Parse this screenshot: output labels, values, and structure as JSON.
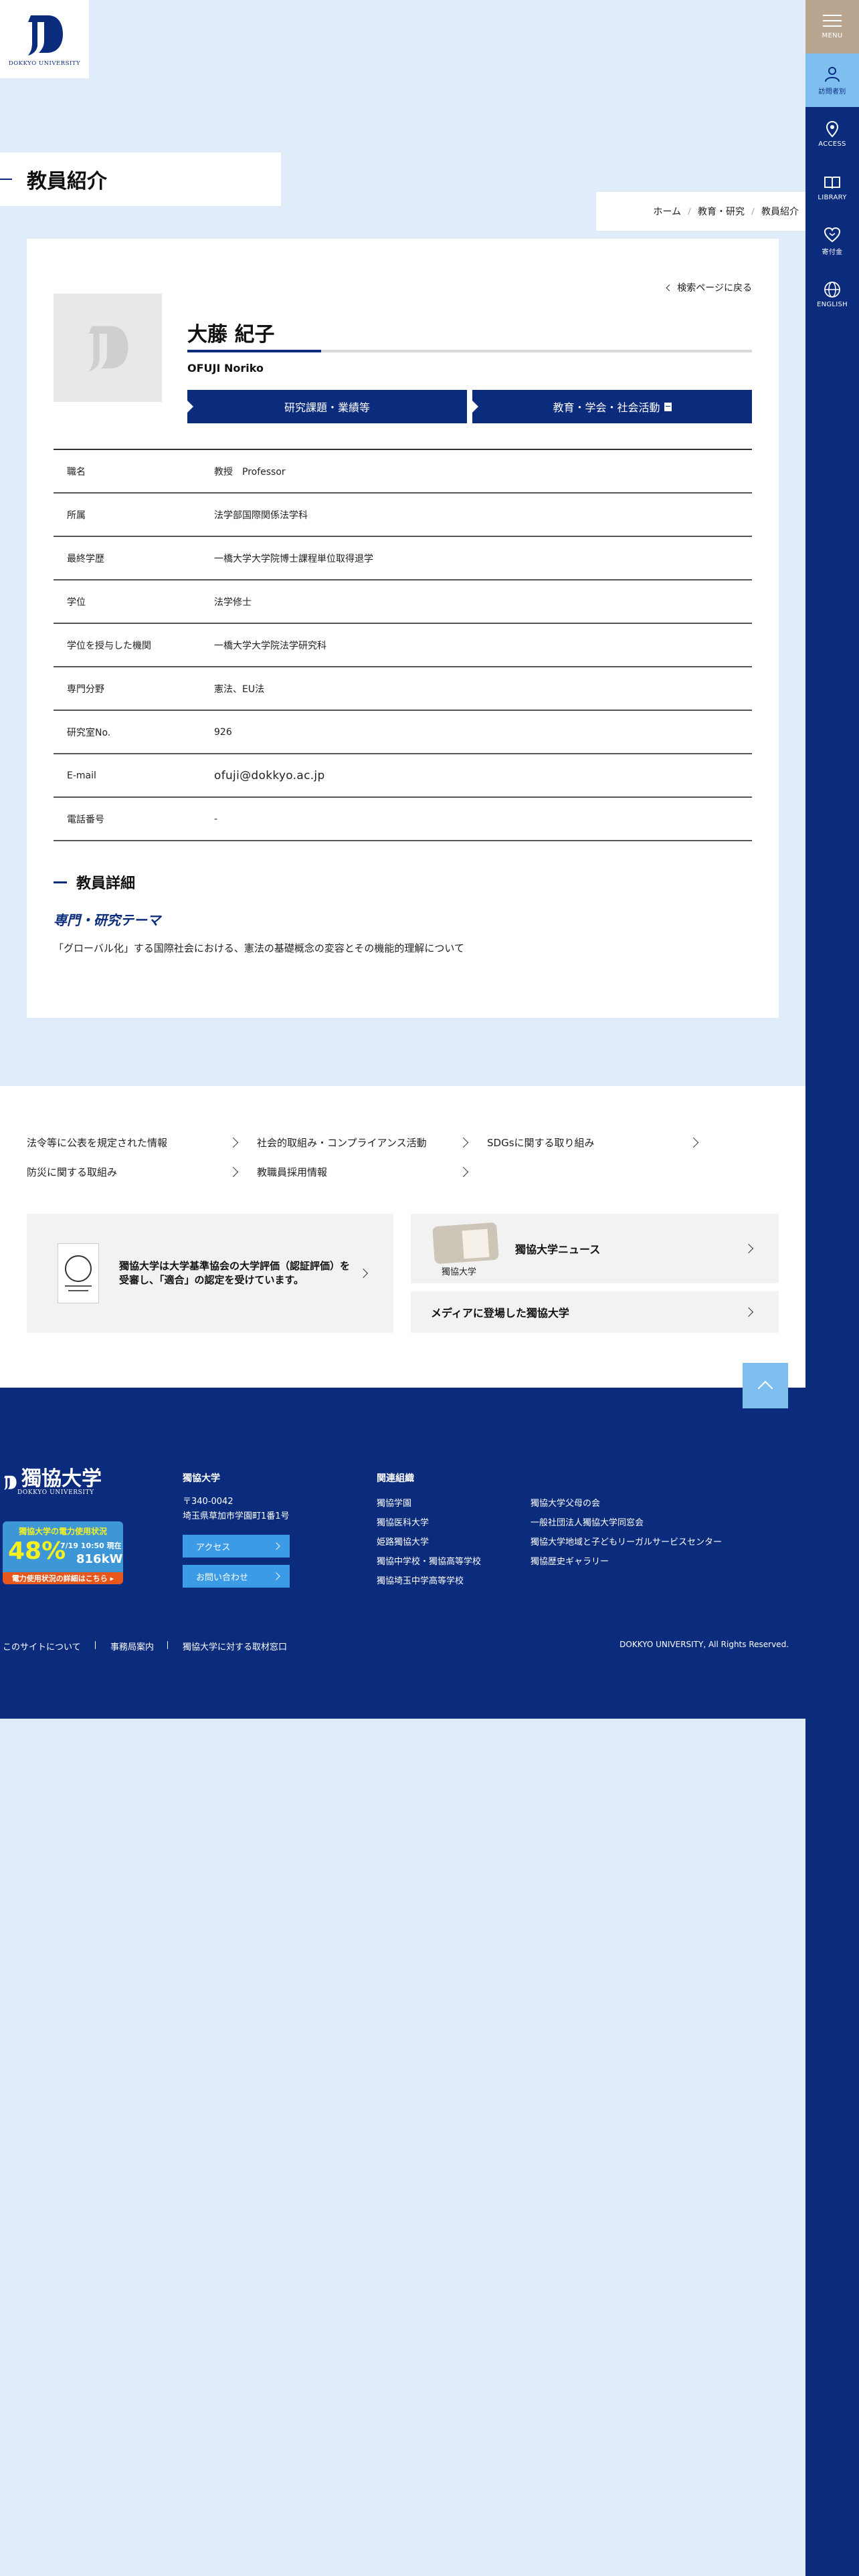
{
  "logo": {
    "text": "DOKKYO UNIVERSITY"
  },
  "rail": {
    "menu": "MENU",
    "visitor": "訪問者別",
    "access": "ACCESS",
    "library": "LIBRARY",
    "donation": "寄付金",
    "english": "ENGLISH"
  },
  "page": {
    "title": "教員紹介",
    "breadcrumb": [
      "ホーム",
      "教育・研究",
      "教員紹介"
    ]
  },
  "profile": {
    "back_label": "検索ページに戻る",
    "name": "大藤 紀子",
    "name_roman": "OFUJI Noriko",
    "tab_research": "研究課題・業績等",
    "tab_education": "教育・学会・社会活動",
    "rows": [
      {
        "key": "職名",
        "value": "教授　Professor"
      },
      {
        "key": "所属",
        "value": "法学部国際関係法学科"
      },
      {
        "key": "最終学歴",
        "value": "一橋大学大学院博士課程単位取得退学"
      },
      {
        "key": "学位",
        "value": "法学修士"
      },
      {
        "key": "学位を授与した機関",
        "value": "一橋大学大学院法学研究科"
      },
      {
        "key": "専門分野",
        "value": "憲法、EU法"
      },
      {
        "key": "研究室No.",
        "value": "926"
      },
      {
        "key": "E-mail",
        "value": "ofuji@dokkyo.ac.jp"
      },
      {
        "key": "電話番号",
        "value": "-"
      }
    ],
    "detail_title": "教員詳細",
    "topic_heading": "専門・研究テーマ",
    "topic_body": "「グローバル化」する国際社会における、憲法の基礎概念の変容とその機能的理解について"
  },
  "links": [
    "法令等に公表を規定された情報",
    "社会的取組み・コンプライアンス活動",
    "SDGsに関する取り組み",
    "防災に関する取組み",
    "教職員採用情報"
  ],
  "banners": {
    "evaluation_line1": "獨協大学は大学基準協会の大学評価（認証評価）を",
    "evaluation_line2": "受審し、「適合」の認定を受けています。",
    "news_caption": "獨協大学",
    "news": "獨協大学ニュース",
    "media": "メディアに登場した獨協大学"
  },
  "footer": {
    "logo_jp": "獨協大学",
    "logo_en": "DOKKYO UNIVERSITY",
    "power_title": "獨協大学の電力使用状況",
    "power_pct": "48%",
    "power_datetime": "7/19 10:50 現在",
    "power_kw": "816kW",
    "power_link": "電力使用状況の詳細はこちら ▸",
    "univ_title": "獨協大学",
    "postal": "〒340-0042",
    "address": "埼玉県草加市学園町1番1号",
    "access_btn": "アクセス",
    "contact_btn": "お問い合わせ",
    "related_title": "関連組織",
    "related_col1": [
      "獨協学園",
      "獨協医科大学",
      "姫路獨協大学",
      "獨協中学校・獨協高等学校",
      "獨協埼玉中学高等学校"
    ],
    "related_col2": [
      "獨協大学父母の会",
      "一般社団法人獨協大学同窓会",
      "獨協大学地域と子どもリーガルサービスセンター",
      "獨協歴史ギャラリー"
    ],
    "bottom_links": [
      "このサイトについて",
      "事務局案内",
      "獨協大学に対する取材窓口"
    ],
    "copyright": "DOKKYO UNIVERSITY, All Rights Reserved."
  },
  "colors": {
    "navy": "#0b2b7d",
    "light_blue": "#7fbff0",
    "bg": "#e1ecfa",
    "beige": "#b9a690"
  }
}
